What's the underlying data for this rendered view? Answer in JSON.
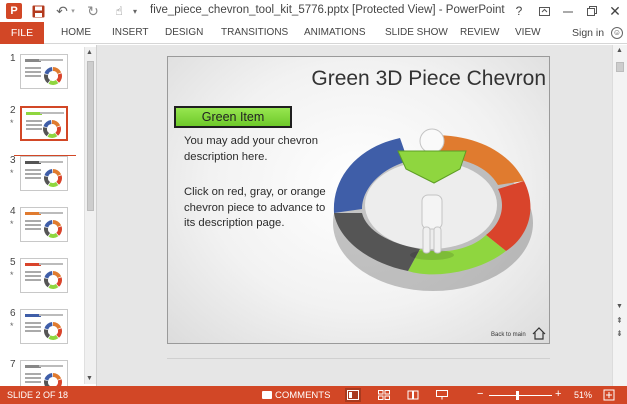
{
  "app": {
    "window_title": "five_piece_chevron_tool_kit_5776.pptx [Protected View] - PowerPoint",
    "logo_letter": "P",
    "help_label": "?",
    "close_label": "✕",
    "sign_in": "Sign in"
  },
  "ribbon": {
    "file": "FILE",
    "tabs": [
      "HOME",
      "INSERT",
      "DESIGN",
      "TRANSITIONS",
      "ANIMATIONS",
      "SLIDE SHOW",
      "REVIEW",
      "VIEW"
    ]
  },
  "thumbnails": [
    {
      "number": "1",
      "star": "",
      "accent": "#888888"
    },
    {
      "number": "2",
      "star": "*",
      "accent": "#8fd63f"
    },
    {
      "number": "3",
      "star": "*",
      "accent": "#555555"
    },
    {
      "number": "4",
      "star": "*",
      "accent": "#e07b2f"
    },
    {
      "number": "5",
      "star": "*",
      "accent": "#d9442b"
    },
    {
      "number": "6",
      "star": "*",
      "accent": "#3f5ea8"
    },
    {
      "number": "7",
      "star": "",
      "accent": "#888888"
    }
  ],
  "slide": {
    "title": "Green 3D Piece Chevron",
    "button_label": "Green Item",
    "description_1": "You may add your chevron description here.",
    "description_2": "Click on red, gray, or orange chevron piece to advance to its description page.",
    "back_link": "Back to main",
    "colors": {
      "green": "#8fd63f",
      "orange": "#e07b2f",
      "red": "#d9442b",
      "gray": "#555555",
      "blue": "#3f5ea8"
    }
  },
  "status": {
    "slide_counter": "SLIDE 2 OF 18",
    "comments": "COMMENTS",
    "zoom_minus": "−",
    "zoom_plus": "+",
    "zoom_level": "51%",
    "zoom_fraction": 0.51
  },
  "colors": {
    "accent": "#d24726",
    "slide_border": "#9a9a9a"
  }
}
